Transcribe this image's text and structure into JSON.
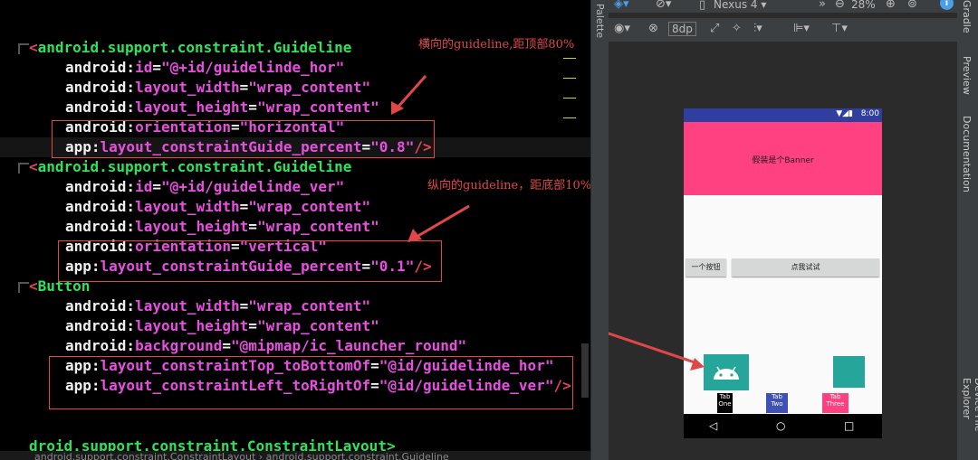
{
  "editor": {
    "lines": [
      {
        "indent": 0,
        "tag": "android.support.constraint.Guideline"
      },
      {
        "attr_ns": "android",
        "attr": "id",
        "value": "\"@+id/guidelinde_hor\"",
        "close": ""
      },
      {
        "attr_ns": "android",
        "attr": "layout_width",
        "value": "\"wrap_content\"",
        "close": ""
      },
      {
        "attr_ns": "android",
        "attr": "layout_height",
        "value": "\"wrap_content\"",
        "close": ""
      },
      {
        "attr_ns": "android",
        "attr": "orientation",
        "value": "\"horizontal\"",
        "close": ""
      },
      {
        "attr_ns": "app",
        "attr": "layout_constraintGuide_percent",
        "value": "\"0.8\"",
        "close": "/>"
      },
      {
        "indent": 0,
        "tag": "android.support.constraint.Guideline"
      },
      {
        "attr_ns": "android",
        "attr": "id",
        "value": "\"@+id/guidelinde_ver\"",
        "close": ""
      },
      {
        "attr_ns": "android",
        "attr": "layout_width",
        "value": "\"wrap_content\"",
        "close": ""
      },
      {
        "attr_ns": "android",
        "attr": "layout_height",
        "value": "\"wrap_content\"",
        "close": ""
      },
      {
        "attr_ns": "android",
        "attr": "orientation",
        "value": "\"vertical\"",
        "close": ""
      },
      {
        "attr_ns": "app",
        "attr": "layout_constraintGuide_percent",
        "value": "\"0.1\"",
        "close": "/>"
      },
      {
        "indent": 0,
        "tag": "Button"
      },
      {
        "attr_ns": "android",
        "attr": "layout_width",
        "value": "\"wrap_content\"",
        "close": ""
      },
      {
        "attr_ns": "android",
        "attr": "layout_height",
        "value": "\"wrap_content\"",
        "close": ""
      },
      {
        "attr_ns": "android",
        "attr": "background",
        "value": "\"@mipmap/ic_launcher_round\"",
        "close": ""
      },
      {
        "attr_ns": "app",
        "attr": "layout_constraintTop_toBottomOf",
        "value": "\"@id/guidelinde_hor\"",
        "close": ""
      },
      {
        "attr_ns": "app",
        "attr": "layout_constraintLeft_toRightOf",
        "value": "\"@id/guidelinde_ver\"",
        "close": "/>"
      }
    ],
    "bottom_tag": "droid.support.constraint.ConstraintLayout>",
    "breadcrumb": "android.support.constraint.ConstraintLayout  ›  android.support.constraint.Guideline",
    "annotation_horizontal": "横向的guideline,距顶部80%",
    "annotation_vertical": "纵向的guideline，距底部10%"
  },
  "palette_label": "Palette",
  "toolbar": {
    "device": "Nexus 4",
    "zoom": "28%",
    "margin": "8dp"
  },
  "right_strip": {
    "gradle": "Gradle",
    "preview": "Preview",
    "documentation": "Documentation",
    "device_file": "Device File Explorer"
  },
  "phone": {
    "time": "8:00",
    "banner_text": "假装是个Banner",
    "button_left": "一个按钮",
    "button_wide": "点我试试",
    "tab_one": "Tab One",
    "tab_two": "Tab Two",
    "tab_three": "Tab Three",
    "colors": {
      "status": "#303f9f",
      "banner": "#ff4081",
      "launcher": "#26a69a"
    }
  }
}
